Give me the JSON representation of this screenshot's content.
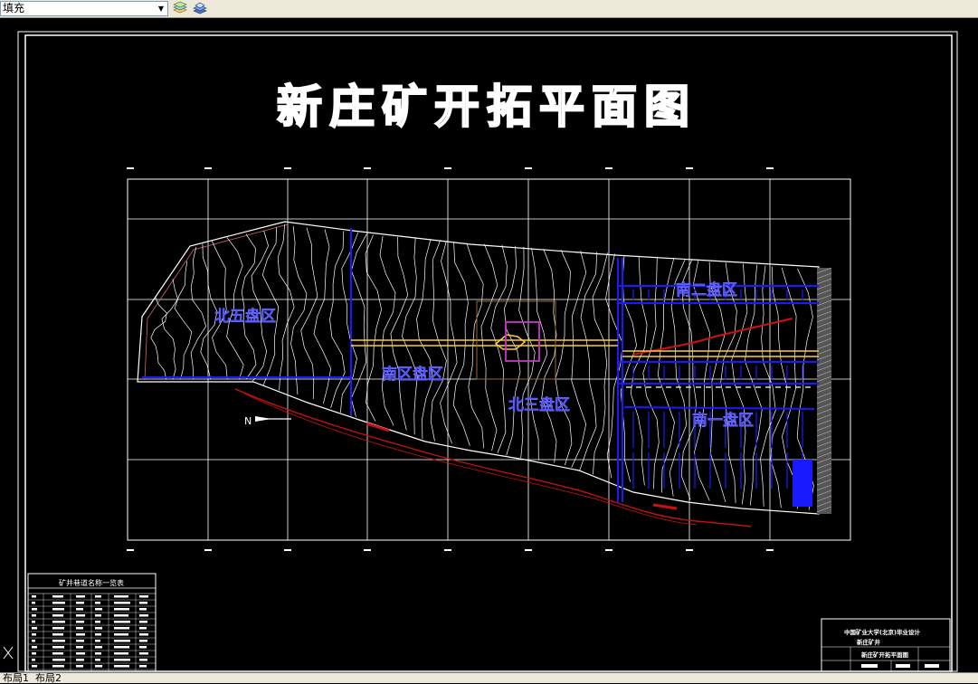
{
  "toolbar": {
    "property_value": "填充",
    "dropdown_arrow": "▼",
    "icons": [
      "layer-manager-icon",
      "layer-states-icon"
    ]
  },
  "drawing": {
    "title": "新庄矿开拓平面图",
    "panel_labels": [
      "北五盘区",
      "南区盘区",
      "北三盘区",
      "南二盘区",
      "南一盘区"
    ],
    "legend_table_title": "矿井巷道名称一览表",
    "title_block": {
      "line1": "中国矿业大学(北京)毕业设计",
      "line2": "新庄矿井",
      "line3": "新庄矿开拓平面图"
    }
  },
  "colors": {
    "background": "#000000",
    "frame": "#ffffff",
    "contour": "#ffffff",
    "roadway_blue": "#1a1aff",
    "roadway_yellow": "#ffcc33",
    "boundary_red": "#cc1111",
    "shaft_magenta": "#cc33cc",
    "panel_label": "#2222ff"
  },
  "layout_tabs": [
    "布局1",
    "布局2"
  ]
}
